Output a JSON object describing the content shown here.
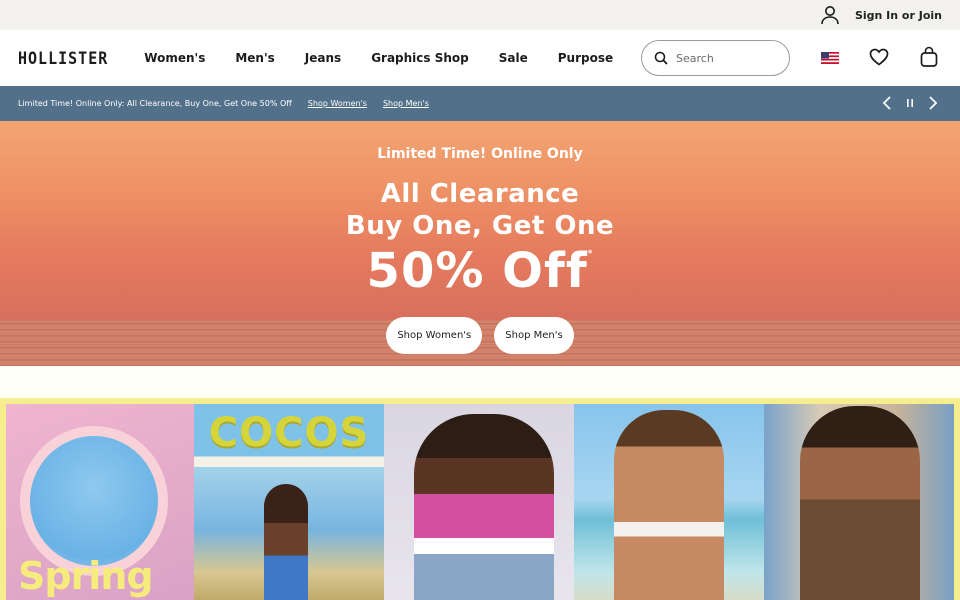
{
  "utility": {
    "account_icon": "person-icon",
    "signin_label": "Sign In or Join"
  },
  "header": {
    "logo": "HOLLISTER",
    "nav": [
      {
        "label": "Women's"
      },
      {
        "label": "Men's"
      },
      {
        "label": "Jeans"
      },
      {
        "label": "Graphics Shop"
      },
      {
        "label": "Sale"
      },
      {
        "label": "Purpose"
      }
    ],
    "search_placeholder": "Search",
    "region_icon": "us-flag-icon",
    "wishlist_icon": "heart-icon",
    "bag_icon": "shopping-bag-icon"
  },
  "promo": {
    "message": "Limited Time! Online Only: All Clearance, Buy One, Get One 50% Off",
    "links": [
      "Shop Women's",
      "Shop Men's"
    ],
    "bg": "#53708a"
  },
  "hero": {
    "kicker": "Limited Time! Online Only",
    "line1": "All Clearance",
    "line2": "Buy One, Get One",
    "big": "50% Off",
    "asterisk": "*",
    "buttons": [
      "Shop Women's",
      "Shop Men's"
    ]
  },
  "gallery": {
    "tile1_text": "Spring",
    "tile2_text": "COCOS",
    "bg": "#f6ee8e"
  }
}
